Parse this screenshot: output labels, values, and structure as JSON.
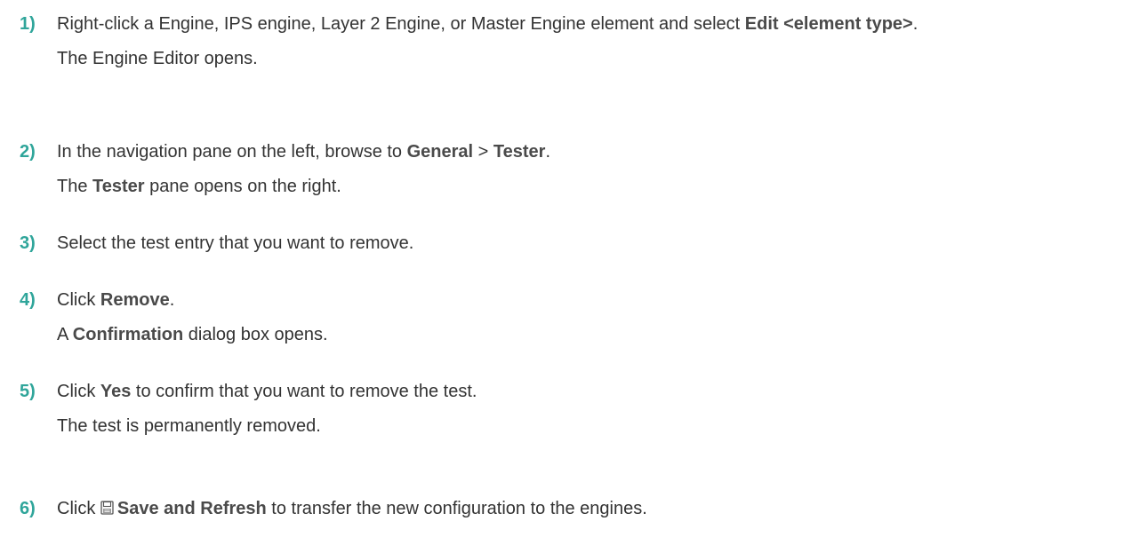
{
  "colors": {
    "step_number": "#2fa59a",
    "text": "#333333"
  },
  "steps": [
    {
      "number": "1)",
      "a_1": "Right-click a Engine, IPS engine, Layer 2 Engine, or Master Engine element and select ",
      "a_2": "Edit <element type>",
      "a_3": ".",
      "b": "The Engine Editor opens."
    },
    {
      "number": "2)",
      "a_1": "In the navigation pane on the left, browse to ",
      "a_2": "General",
      "a_3": " > ",
      "a_4": "Tester",
      "a_5": ".",
      "b_1": "The ",
      "b_2": "Tester",
      "b_3": " pane opens on the right."
    },
    {
      "number": "3)",
      "a": "Select the test entry that you want to remove."
    },
    {
      "number": "4)",
      "a_1": "Click ",
      "a_2": "Remove",
      "a_3": ".",
      "b_1": "A ",
      "b_2": "Confirmation",
      "b_3": " dialog box opens."
    },
    {
      "number": "5)",
      "a_1": "Click ",
      "a_2": "Yes",
      "a_3": " to confirm that you want to remove the test.",
      "b": "The test is permanently removed."
    },
    {
      "number": "6)",
      "a_1": "Click ",
      "icon": "save-icon",
      "a_2": "Save and Refresh",
      "a_3": " to transfer the new configuration to the engines."
    }
  ]
}
